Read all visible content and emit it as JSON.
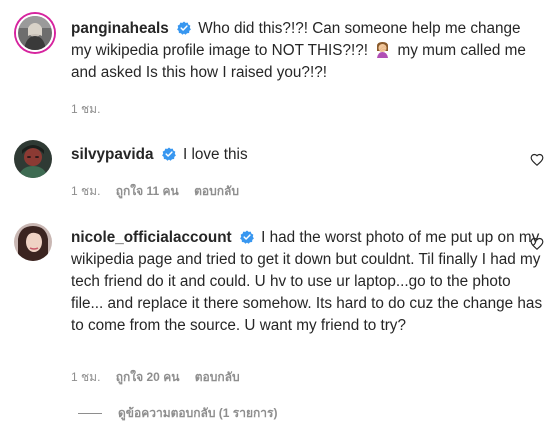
{
  "comments": [
    {
      "username": "panginaheals",
      "text_before_emoji": "Who did this?!?! Can someone help me change my wikipedia profile image to NOT THIS?!?!",
      "emoji": "facepalm-woman",
      "text_after_emoji": "my mum called me and asked Is this how I raised you?!?!",
      "time": "1 ชม."
    },
    {
      "username": "silvypavida",
      "text": "I love this",
      "time": "1 ชม.",
      "likes": "ถูกใจ 11 คน",
      "reply_label": "ตอบกลับ"
    },
    {
      "username": "nicole_officialaccount",
      "text": "I had the worst photo of me put up on my wikipedia page and tried to get it down but couldnt. Til finally I had my tech friend do it and could. U hv to use ur laptop...go to the photo file... and replace it there somehow. Its hard to do cuz the change has to come from the source. U want my friend to try?",
      "time": "1 ชม.",
      "likes": "ถูกใจ 20 คน",
      "reply_label": "ตอบกลับ"
    }
  ],
  "view_replies": "ดูข้อความตอบกลับ (1 รายการ)",
  "colors": {
    "verified": "#3897f0",
    "meta": "#8e8e8e",
    "text": "#262626"
  }
}
